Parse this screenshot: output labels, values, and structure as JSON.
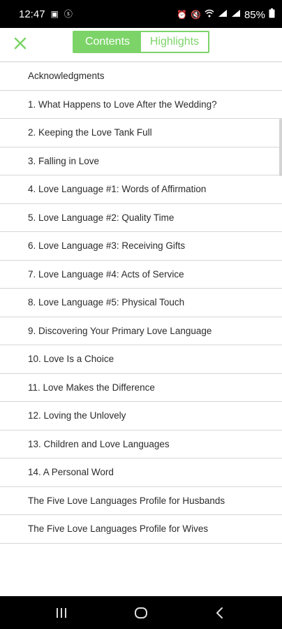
{
  "status_bar": {
    "time": "12:47",
    "battery": "85%"
  },
  "header": {
    "tabs": [
      "Contents",
      "Highlights"
    ],
    "active_tab": "Contents",
    "accent": "#7cd468"
  },
  "toc": [
    "Acknowledgments",
    "1.  What Happens to Love After the Wedding?",
    "2.  Keeping the Love Tank Full",
    "3.  Falling in Love",
    "4.  Love Language #1: Words of Affirmation",
    "5.  Love Language #2: Quality Time",
    "6.  Love Language #3: Receiving Gifts",
    "7.  Love Language #4: Acts of Service",
    "8.  Love Language #5: Physical Touch",
    "9.  Discovering Your Primary Love Language",
    "10.  Love Is a Choice",
    "11.  Love Makes the Difference",
    "12.  Loving the Unlovely",
    "13.  Children and Love Languages",
    "14.  A Personal Word",
    "The Five Love Languages Profile for Husbands",
    "The Five Love Languages Profile for Wives"
  ],
  "icons": {
    "close": "close-icon",
    "recent_apps": "recent-apps-icon",
    "home": "home-icon",
    "back": "back-icon"
  }
}
